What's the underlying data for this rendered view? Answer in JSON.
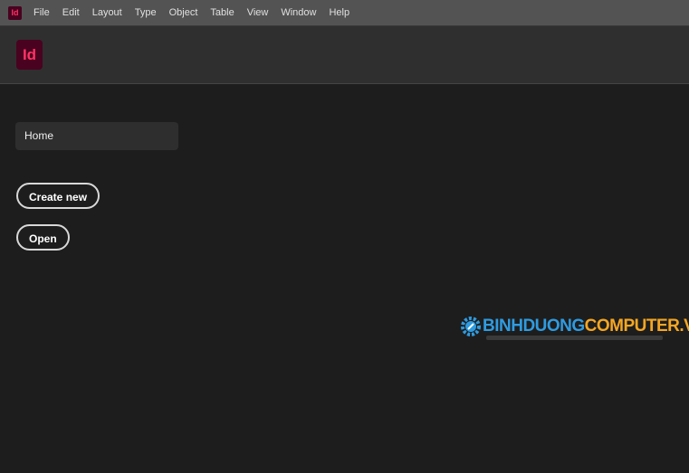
{
  "app": {
    "icon_text": "Id",
    "brand_color": "#ff3366"
  },
  "menu": [
    "File",
    "Edit",
    "Layout",
    "Type",
    "Object",
    "Table",
    "View",
    "Window",
    "Help"
  ],
  "sidebar": {
    "home": "Home",
    "create_new": "Create new",
    "open": "Open"
  },
  "watermark": {
    "part1": "BINHDUONG",
    "part2": "COMPUTER.VN",
    "color1": "#2f9be0",
    "color2": "#f5a623"
  }
}
